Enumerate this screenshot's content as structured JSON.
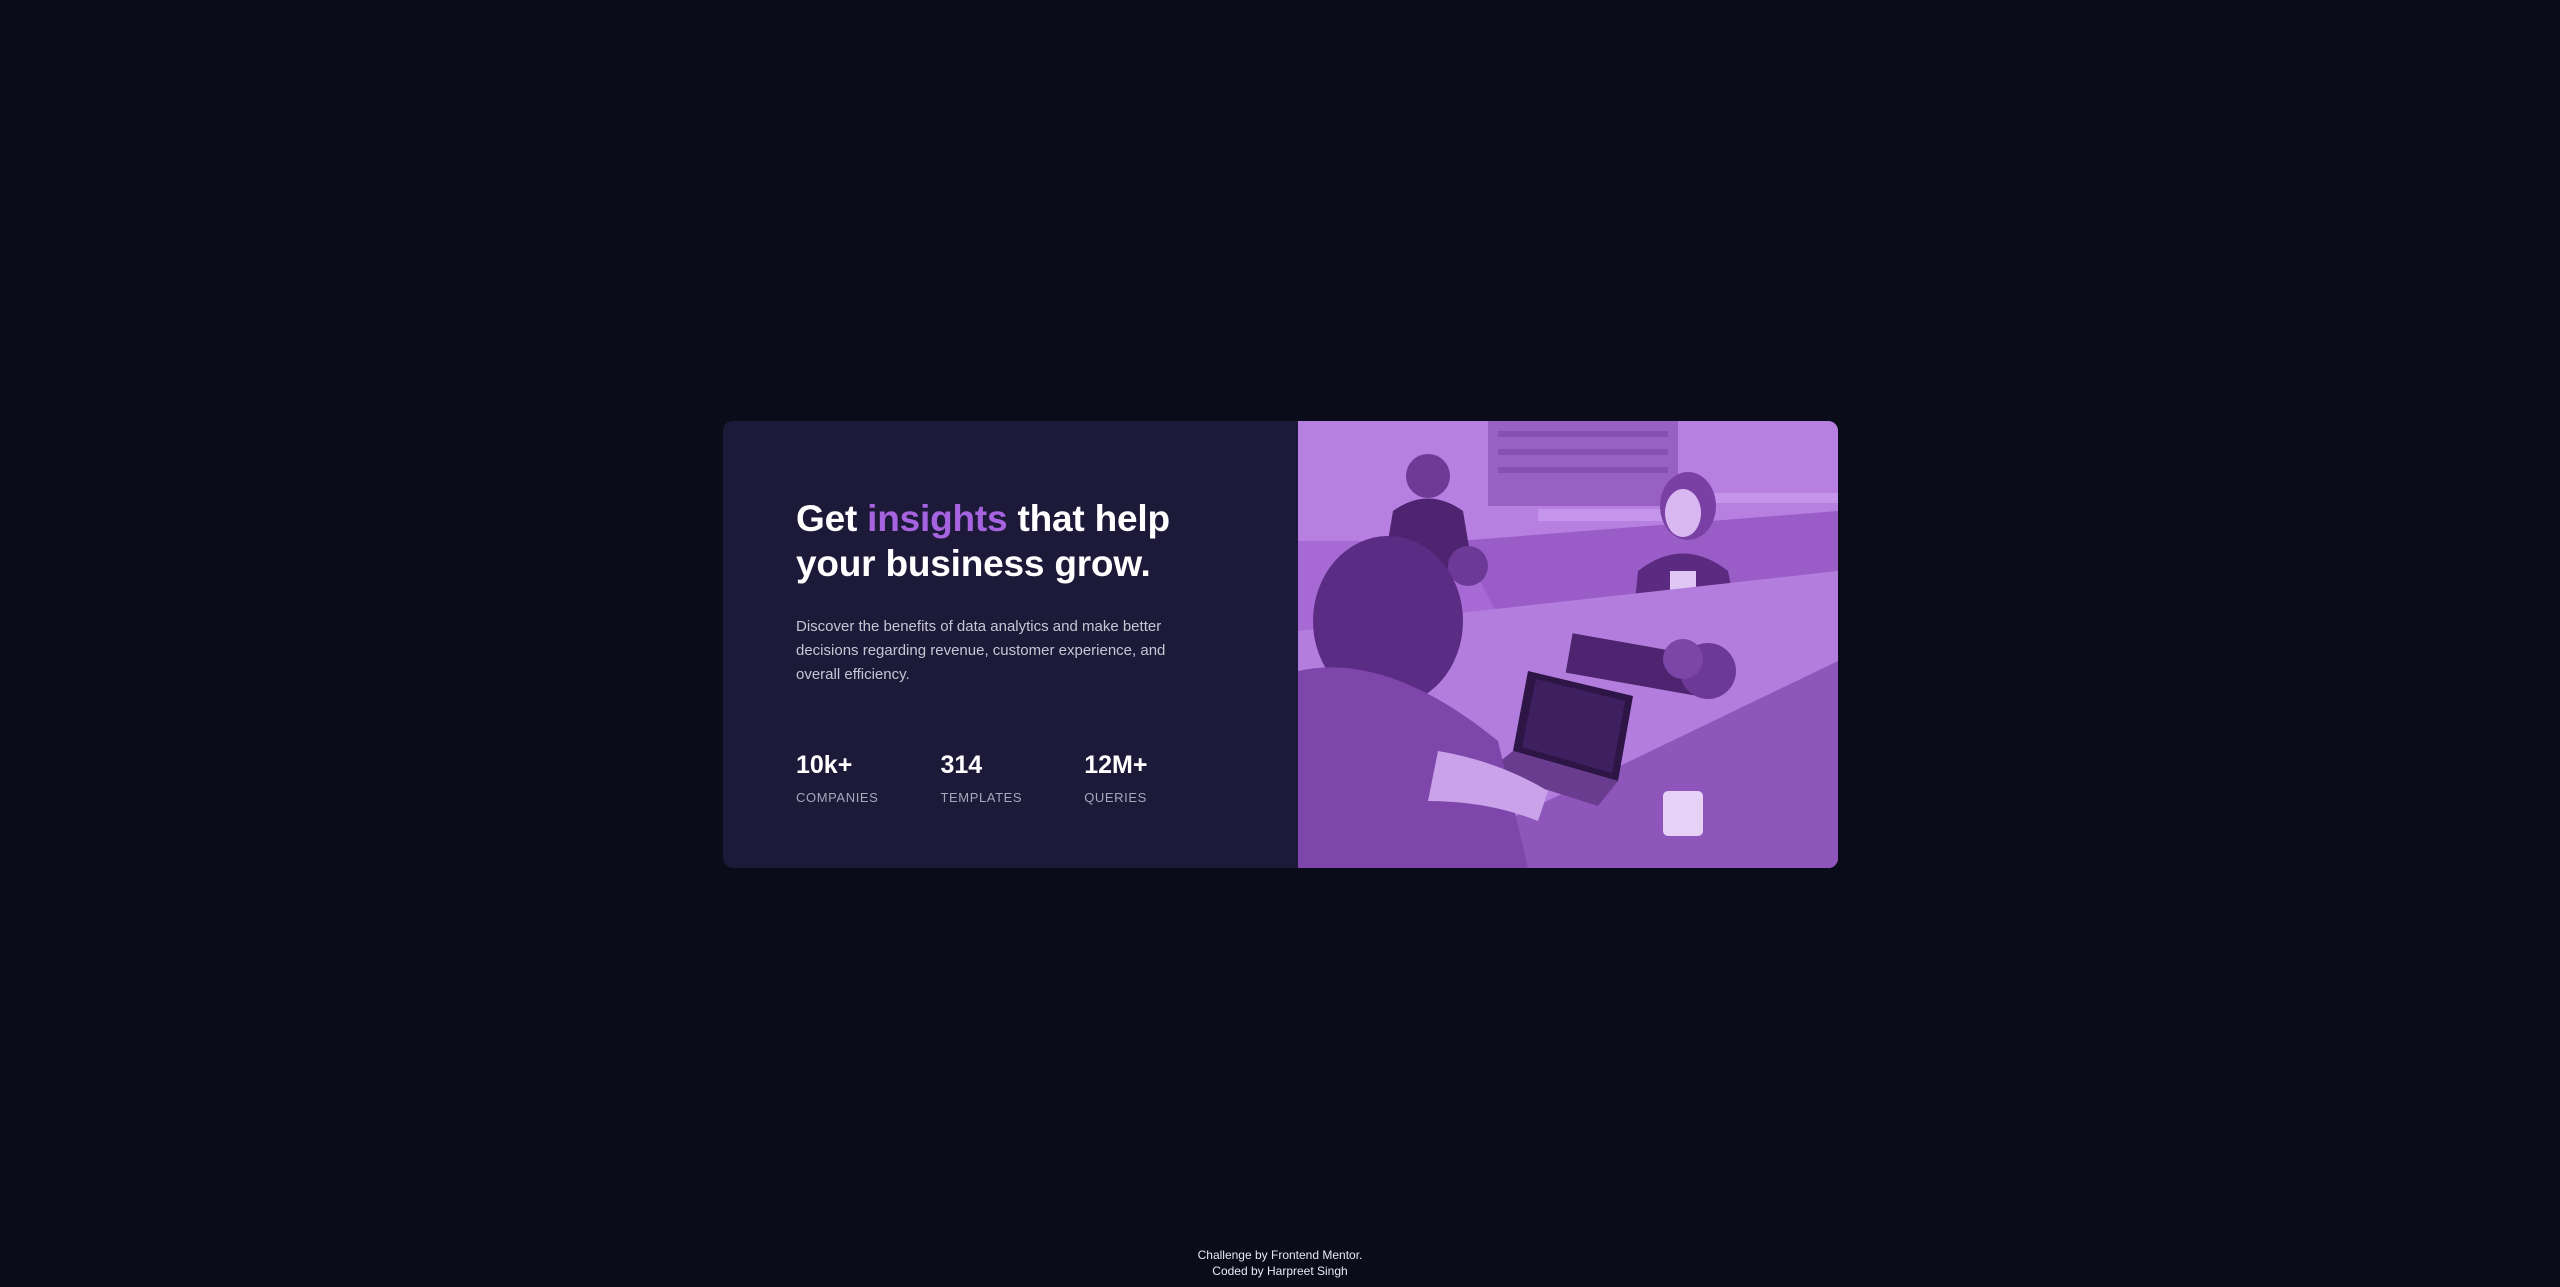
{
  "hero": {
    "heading_before": "Get ",
    "heading_accent": "insights",
    "heading_after": " that help your business grow.",
    "description": "Discover the benefits of data analytics and make better decisions regarding revenue, customer experience, and overall efficiency."
  },
  "stats": [
    {
      "value": "10k+",
      "label": "Companies"
    },
    {
      "value": "314",
      "label": "Templates"
    },
    {
      "value": "12M+",
      "label": "Queries"
    }
  ],
  "image": {
    "description": "Photo of people working at a table with laptops, purple tinted"
  },
  "footer": {
    "line1": "Challenge by Frontend Mentor.",
    "line2": "Coded by Harpreet Singh"
  },
  "colors": {
    "background": "#0a0c1a",
    "card": "#1c1a38",
    "accent": "#a663e0",
    "image_tint": "#9b5fc4"
  }
}
